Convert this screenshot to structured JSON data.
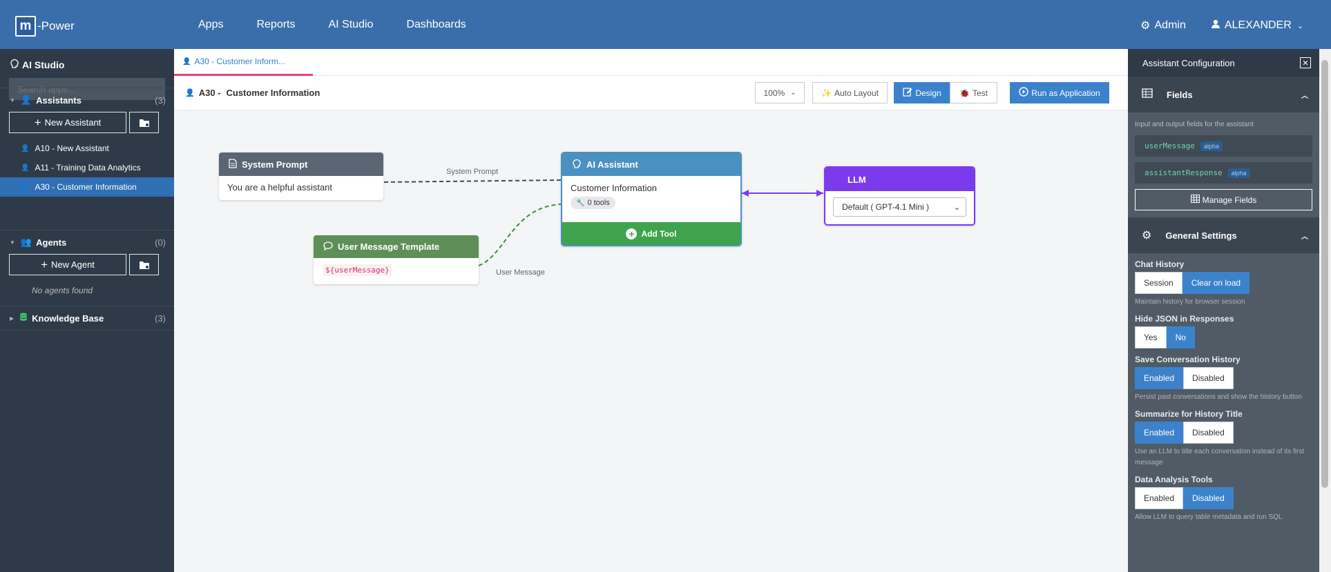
{
  "app": {
    "logo_mark": "m",
    "logo_text": "-Power"
  },
  "nav": {
    "items": [
      "Apps",
      "Reports",
      "AI Studio",
      "Dashboards"
    ]
  },
  "user": {
    "admin_label": "Admin",
    "username": "ALEXANDER"
  },
  "sidebar": {
    "title": "AI Studio",
    "search_placeholder": "Search apps...",
    "assistants": {
      "label": "Assistants",
      "count": "(3)",
      "new_label": "New Assistant",
      "items": [
        "A10 - New Assistant",
        "A11 - Training Data Analytics",
        "A30 - Customer Information"
      ],
      "active_index": 2
    },
    "agents": {
      "label": "Agents",
      "count": "(0)",
      "new_label": "New Agent",
      "empty": "No agents found"
    },
    "knowledge": {
      "label": "Knowledge Base",
      "count": "(3)"
    }
  },
  "tab": {
    "label": "A30 - Customer Inform..."
  },
  "toolbar": {
    "title_prefix": "A30 -",
    "title": "Customer Information",
    "zoom": "100%",
    "auto_layout": "Auto Layout",
    "design": "Design",
    "test": "Test",
    "run": "Run as Application"
  },
  "canvas": {
    "system_prompt": {
      "title": "System Prompt",
      "body": "You are a helpful assistant",
      "color": "#5b6674"
    },
    "user_template": {
      "title": "User Message Template",
      "body": "${userMessage}",
      "color": "#5e8f57"
    },
    "assistant": {
      "title": "AI Assistant",
      "name": "Customer Information",
      "tools": "0 tools",
      "add_tool": "Add Tool",
      "color": "#4a90c0",
      "add_color": "#3fa34d"
    },
    "llm": {
      "title": "LLM",
      "model": "Default ( GPT-4.1 Mini )",
      "color": "#7c3aed"
    },
    "edge_labels": {
      "system": "System Prompt",
      "user": "User Message"
    }
  },
  "panel": {
    "title": "Assistant Configuration",
    "fields_section": "Fields",
    "fields_hint": "Input and output fields for the assistant",
    "fields": [
      {
        "name": "userMessage",
        "type": "alpha"
      },
      {
        "name": "assistantResponse",
        "type": "alpha"
      }
    ],
    "manage_fields": "Manage Fields",
    "general_section": "General Settings",
    "settings": [
      {
        "label": "Chat History",
        "options": [
          "Session",
          "Clear on load"
        ],
        "selected": 1,
        "desc": "Maintain history for browser session"
      },
      {
        "label": "Hide JSON in Responses",
        "options": [
          "Yes",
          "No"
        ],
        "selected": 1,
        "desc": ""
      },
      {
        "label": "Save Conversation History",
        "options": [
          "Enabled",
          "Disabled"
        ],
        "selected": 0,
        "desc": "Persist past conversations and show the history button"
      },
      {
        "label": "Summarize for History Title",
        "options": [
          "Enabled",
          "Disabled"
        ],
        "selected": 0,
        "desc": "Use an LLM to title each conversation instead of its first message"
      },
      {
        "label": "Data Analysis Tools",
        "options": [
          "Enabled",
          "Disabled"
        ],
        "selected": 1,
        "desc": "Allow LLM to query table metadata and run SQL"
      }
    ]
  },
  "colors": {
    "topbar": "#3a6eaa",
    "sidebar": "#2e3a47",
    "accent": "#3b82cc",
    "tab_underline": "#e6427a"
  }
}
